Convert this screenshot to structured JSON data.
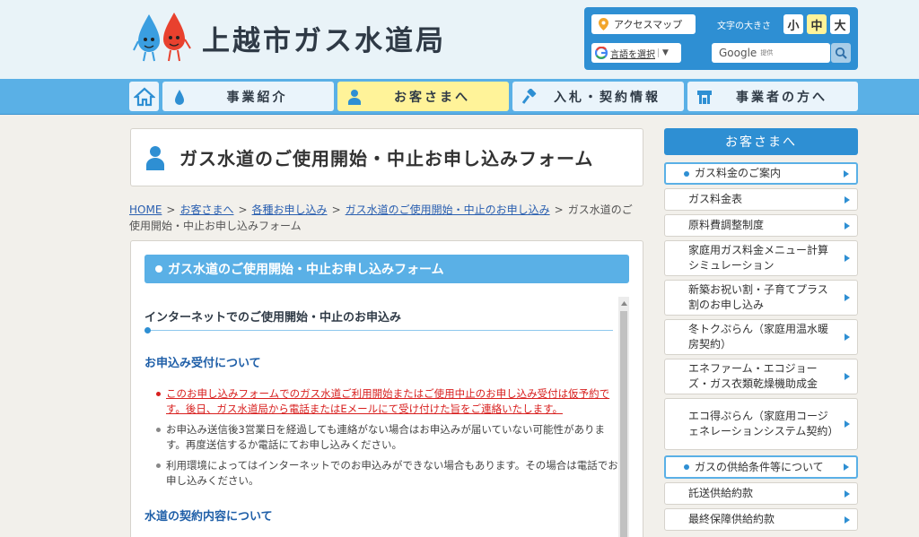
{
  "header": {
    "site_title": "上越市ガス水道局",
    "access_map": "アクセスマップ",
    "font_size_label": "文字の大きさ",
    "font_sizes": [
      "小",
      "中",
      "大"
    ],
    "language_select": "言語を選択",
    "search_brand": "Google",
    "search_powered": "提供"
  },
  "nav": {
    "items": [
      "事業紹介",
      "お客さまへ",
      "入札・契約情報",
      "事業者の方へ"
    ]
  },
  "page": {
    "title": "ガス水道のご使用開始・中止お申し込みフォーム"
  },
  "breadcrumb": {
    "links": [
      "HOME",
      "お客さまへ",
      "各種お申し込み",
      "ガス水道のご使用開始・中止のお申し込み"
    ],
    "current": "ガス水道のご使用開始・中止お申し込みフォーム"
  },
  "content": {
    "heading": "ガス水道のご使用開始・中止お申し込みフォーム",
    "section1": "インターネットでのご使用開始・中止のお申込み",
    "section2": "お申込み受付について",
    "bullets": [
      "このお申し込みフォームでのガス水道ご利用開始またはご使用中止のお申し込み受付は仮予約です。後日、ガス水道局から電話またはEメールにて受け付けた旨をご連絡いたします。",
      "お申込み送信後3営業日を経過しても連絡がない場合はお申込みが届いていない可能性があります。再度送信するか電話にてお申し込みください。",
      "利用環境によってはインターネットでのお申込みができない場合もあります。その場合は電話でお申し込みください。"
    ],
    "section3": "水道の契約内容について"
  },
  "sidebar": {
    "heading": "お客さまへ",
    "items": [
      {
        "label": "ガス料金のご案内",
        "group": true
      },
      {
        "label": "ガス料金表",
        "group": false
      },
      {
        "label": "原料費調整制度",
        "group": false
      },
      {
        "label": "家庭用ガス料金メニュー計算シミュレーション",
        "group": false
      },
      {
        "label": "新築お祝い割・子育てプラス割のお申し込み",
        "group": false
      },
      {
        "label": "冬トクぷらん（家庭用温水暖房契約）",
        "group": false
      },
      {
        "label": "エネファーム・エコジョーズ・ガス衣類乾燥機助成金",
        "group": false
      },
      {
        "label": "エコ得ぷらん（家庭用コージェネレーションシステム契約）",
        "group": false
      },
      {
        "label": "ガスの供給条件等について",
        "group": true
      },
      {
        "label": "託送供給約款",
        "group": false
      },
      {
        "label": "最終保障供給約款",
        "group": false
      }
    ]
  },
  "colors": {
    "accent": "#2e8fd3",
    "nav_bg": "#5ab0e6",
    "active_tab": "#fff399",
    "notice_red": "#d8201f"
  }
}
